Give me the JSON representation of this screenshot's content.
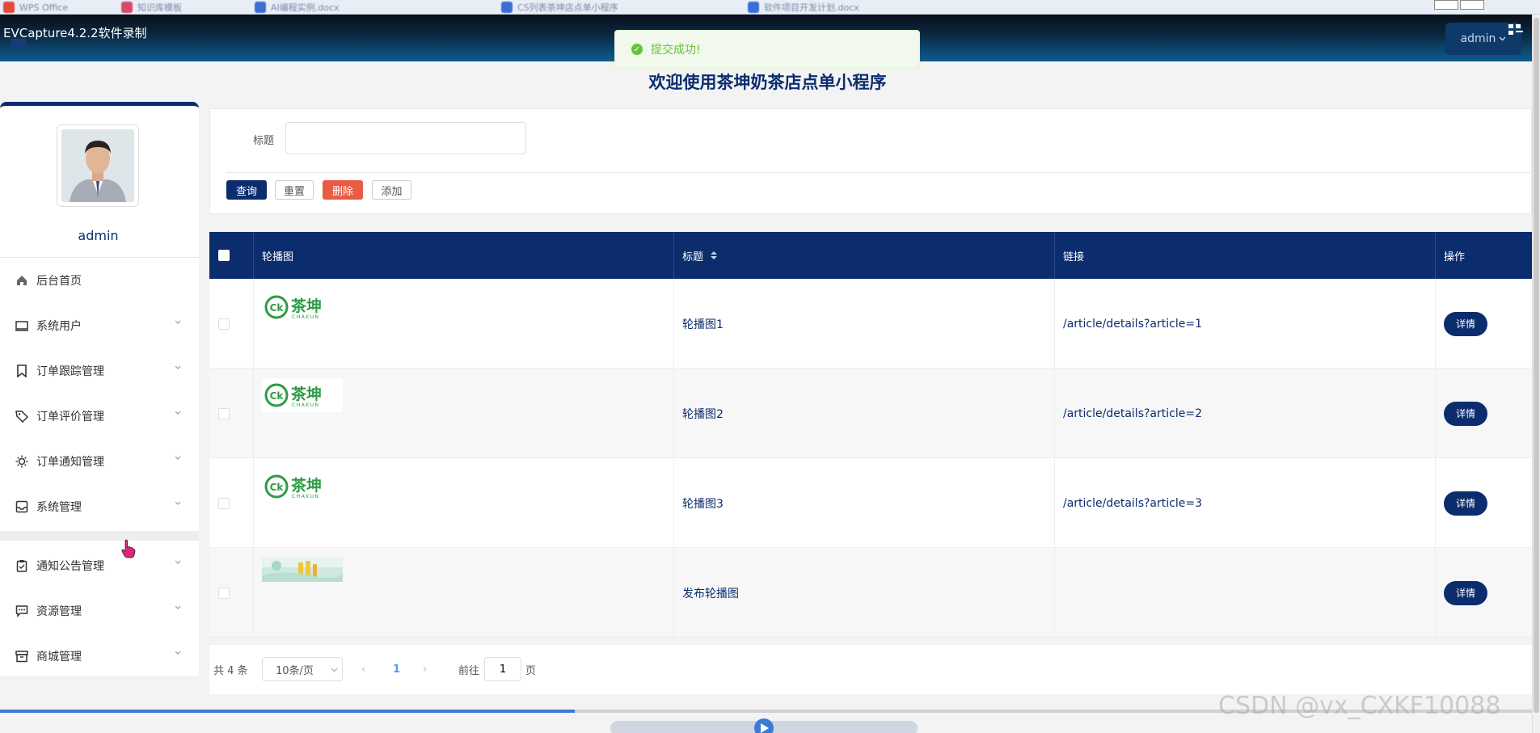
{
  "taskbar": {
    "tabs": [
      "WPS Office",
      "知识库模板",
      "AI编程实例.docx",
      "CS列表茶坤店点单小程序",
      "软件项目开发计划.docx"
    ]
  },
  "header": {
    "app_title": "EVCapture4.2.2软件录制",
    "admin_label": "admin"
  },
  "toast": {
    "message": "提交成功!"
  },
  "page_title": "欢迎使用茶坤奶茶店点单小程序",
  "sidebar": {
    "username": "admin",
    "items": [
      {
        "label": "后台首页",
        "icon": "home-icon",
        "has_children": false
      },
      {
        "label": "系统用户",
        "icon": "monitor-icon",
        "has_children": true
      },
      {
        "label": "订单跟踪管理",
        "icon": "bookmark-icon",
        "has_children": true
      },
      {
        "label": "订单评价管理",
        "icon": "tag-icon",
        "has_children": true
      },
      {
        "label": "订单通知管理",
        "icon": "sun-icon",
        "has_children": true
      },
      {
        "label": "系统管理",
        "icon": "inbox-icon",
        "has_children": true
      },
      {
        "label": "通知公告管理",
        "icon": "clipboard-icon",
        "has_children": true
      },
      {
        "label": "资源管理",
        "icon": "chat-icon",
        "has_children": true
      },
      {
        "label": "商城管理",
        "icon": "archive-icon",
        "has_children": true
      }
    ]
  },
  "search": {
    "label": "标题",
    "value": "",
    "placeholder": ""
  },
  "buttons": {
    "query": "查询",
    "reset": "重置",
    "delete": "删除",
    "add": "添加"
  },
  "table": {
    "columns": [
      "轮播图",
      "标题",
      "链接",
      "操作"
    ],
    "rows": [
      {
        "image": "茶坤 CHAKUN logo",
        "title": "轮播图1",
        "link": "/article/details?article=1",
        "action": "详情"
      },
      {
        "image": "茶坤 CHAKUN logo",
        "title": "轮播图2",
        "link": "/article/details?article=2",
        "action": "详情"
      },
      {
        "image": "茶坤 CHAKUN logo",
        "title": "轮播图3",
        "link": "/article/details?article=3",
        "action": "详情"
      },
      {
        "image": "banner photo",
        "title": "发布轮播图",
        "link": "",
        "action": "详情"
      }
    ]
  },
  "logo_text": {
    "brand": "茶坤",
    "sub": "CHAKUN",
    "mark": "Ck"
  },
  "pagination": {
    "total": "共 4 条",
    "page_size": "10条/页",
    "current": "1",
    "goto_label": "前往",
    "goto_value": "1",
    "page_unit": "页"
  },
  "watermark": "CSDN @vx_CXKF10088",
  "colors": {
    "primary": "#0b2d6e",
    "danger": "#e85c44",
    "success": "#67c23a",
    "logo_green": "#2e9b46"
  },
  "video_progress": 0.375
}
